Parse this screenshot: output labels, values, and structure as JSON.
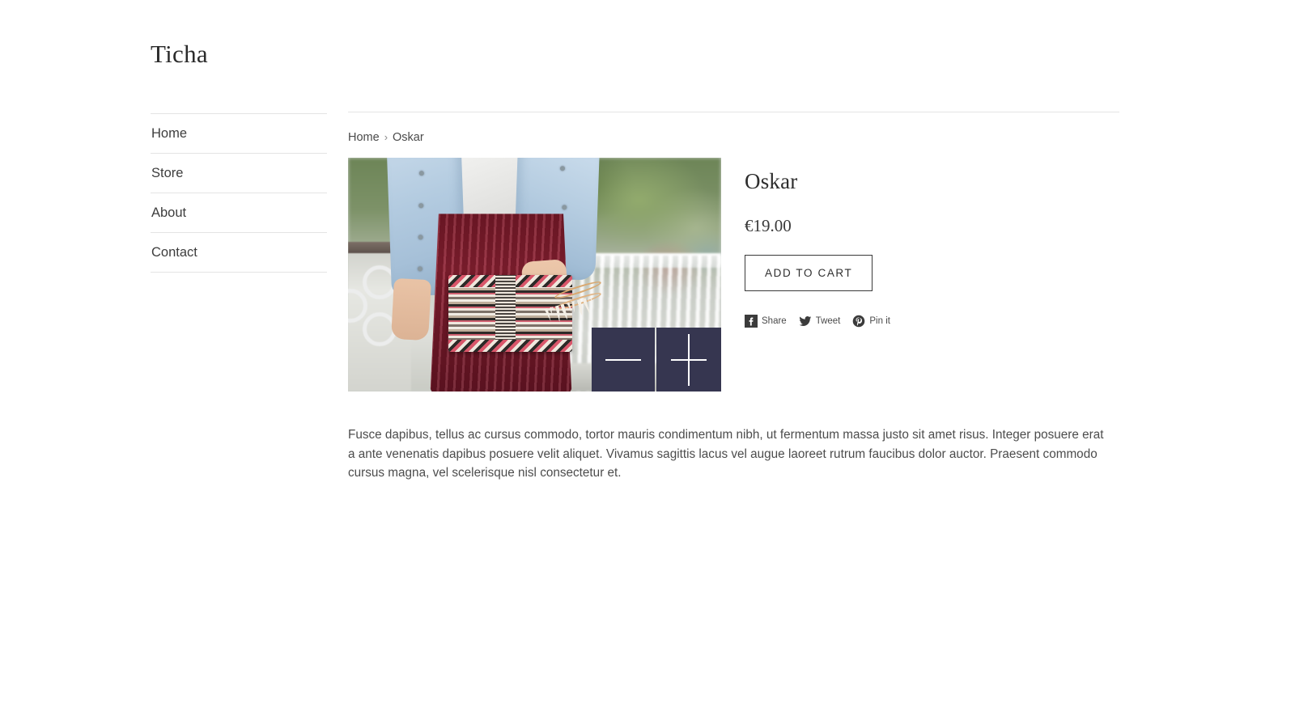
{
  "site": {
    "logo": "Ticha"
  },
  "sidebar": {
    "items": [
      {
        "label": "Home",
        "name": "sidebar-item-home"
      },
      {
        "label": "Store",
        "name": "sidebar-item-store"
      },
      {
        "label": "About",
        "name": "sidebar-item-about"
      },
      {
        "label": "Contact",
        "name": "sidebar-item-contact"
      }
    ]
  },
  "breadcrumb": {
    "home": "Home",
    "separator": "›",
    "current": "Oskar"
  },
  "product": {
    "title": "Oskar",
    "price": "€19.00",
    "add_to_cart_label": "ADD TO CART",
    "description": "Fusce dapibus, tellus ac cursus commodo, tortor mauris condimentum nibh, ut fermentum massa justo sit amet risus. Integer posuere erat a ante venenatis dapibus posuere velit aliquet. Vivamus sagittis lacus vel augue laoreet rutrum faucibus dolor auctor. Praesent commodo cursus magna, vel scelerisque nisl consectetur et.",
    "image_alt": "Woman in denim jacket and burgundy pleated skirt holding an aztec patterned clutch"
  },
  "image_controls": {
    "zoom_out_label": "—",
    "zoom_in_label": "+",
    "overlay_color": "#363650"
  },
  "share": [
    {
      "label": "Share",
      "network": "facebook",
      "icon": "facebook-icon"
    },
    {
      "label": "Tweet",
      "network": "twitter",
      "icon": "twitter-icon"
    },
    {
      "label": "Pin it",
      "network": "pinterest",
      "icon": "pinterest-icon"
    }
  ],
  "colors": {
    "text": "#4c4c4c",
    "heading": "#2d2d2d",
    "rule": "#e4e4e4",
    "overlay_navy": "#363650",
    "social_dark": "#3b3b3b"
  }
}
